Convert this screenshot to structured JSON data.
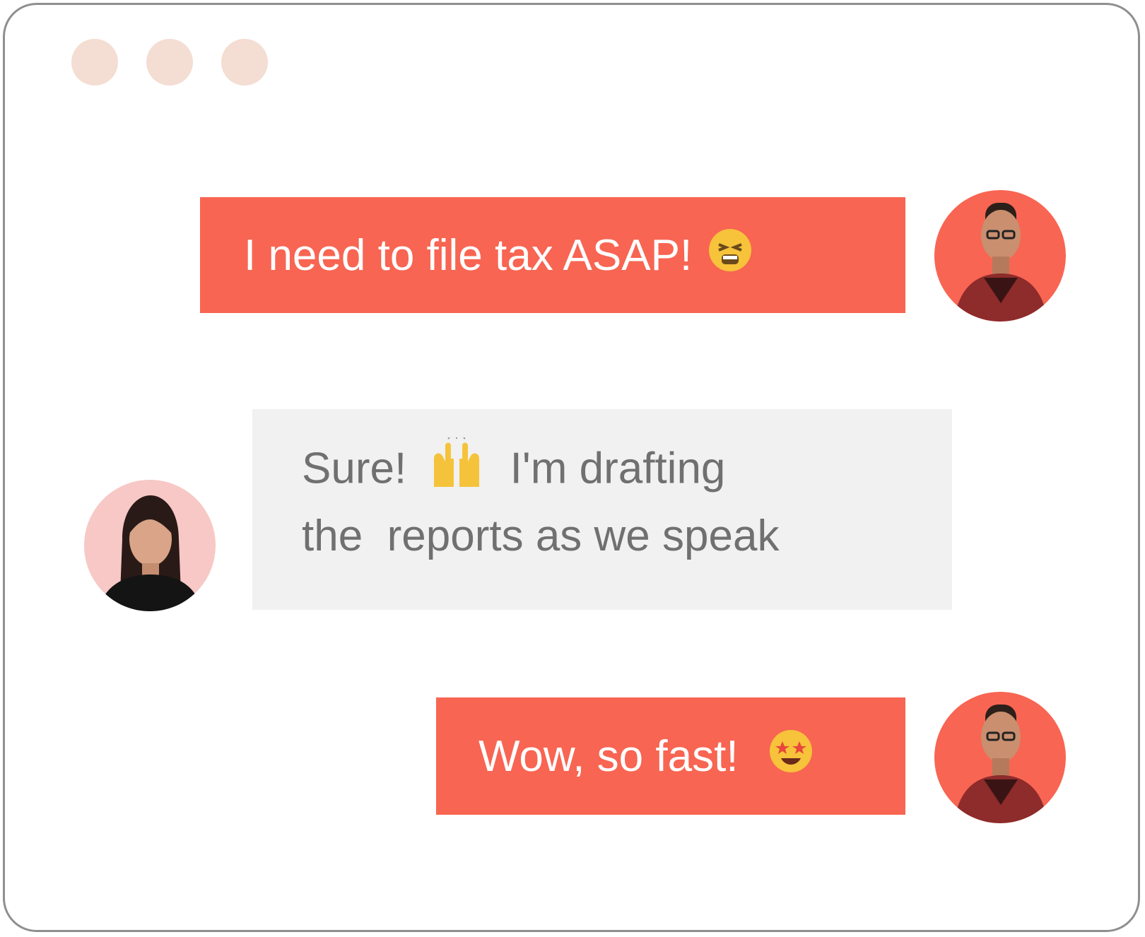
{
  "window": {
    "controls": [
      "window-dot",
      "window-dot",
      "window-dot"
    ]
  },
  "messages": [
    {
      "direction": "outgoing",
      "text": "I need to file tax ASAP!",
      "emoji": "tired-face-emoji"
    },
    {
      "direction": "incoming",
      "line1_prefix": "Sure!",
      "emoji": "raising-hands-emoji",
      "line1_suffix": "I'm drafting",
      "line2": "the  reports as we speak"
    },
    {
      "direction": "outgoing",
      "text": "Wow, so fast!",
      "emoji": "star-struck-emoji"
    }
  ],
  "colors": {
    "outgoing_bubble": "#f86552",
    "incoming_bubble": "#f1f1f1",
    "incoming_text": "#707070",
    "window_dot": "#f4ddd3",
    "border": "#8f8f8f"
  }
}
